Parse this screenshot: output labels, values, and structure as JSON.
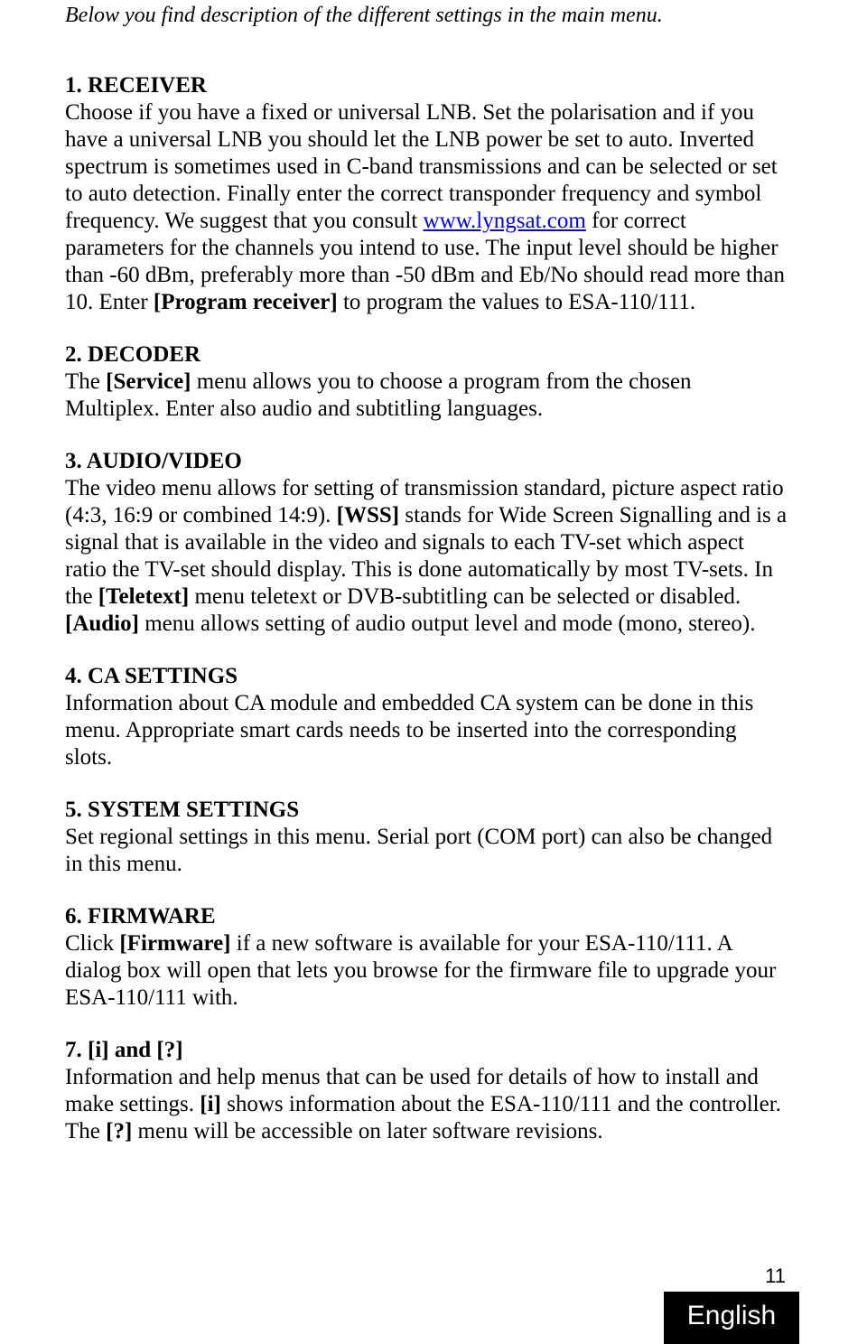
{
  "intro": "Below you find description of the different settings in the main menu.",
  "sections": {
    "s1": {
      "heading": "1. RECEIVER",
      "body_a": "Choose if you have a fixed or universal LNB. Set the polarisation and if you have a universal LNB you should let the LNB power be set to auto. Inverted spectrum is sometimes used in C-band transmissions and can be selected or set to auto detection. Finally enter the correct transponder frequency and symbol frequency. We suggest that you consult  ",
      "link": "www.lyngsat.com",
      "body_b": " for correct parameters for the channels you intend to use. The input level should be higher than -60 dBm, preferably more than -50 dBm and Eb/No should read more than 10. Enter ",
      "bold1": "[Program receiver]",
      "body_c": " to program the values to ESA-110/111."
    },
    "s2": {
      "heading": "2. DECODER",
      "body_a": "The ",
      "bold1": "[Service]",
      "body_b": " menu allows you to choose a program from the chosen Multiplex. Enter also audio and subtitling languages."
    },
    "s3": {
      "heading": "3. AUDIO/VIDEO",
      "body_a": "The video menu allows for setting of transmission standard, picture aspect ratio (4:3, 16:9 or combined 14:9). ",
      "bold1": "[WSS]",
      "body_b": " stands for Wide Screen Signalling and is a signal that is available in the video and signals to each TV-set which aspect ratio the TV-set should display. This is done automatically by most TV-sets. In the ",
      "bold2": "[Teletext]",
      "body_c": " menu teletext or DVB-subtitling can be selected or disabled. ",
      "bold3": "[Audio]",
      "body_d": " menu allows setting of audio output level and mode (mono, stereo)."
    },
    "s4": {
      "heading": "4. CA SETTINGS",
      "body_a": "Information about CA module and embedded CA system can be done in this menu. Appropriate smart cards needs to be inserted into the corresponding slots."
    },
    "s5": {
      "heading": "5. SYSTEM SETTINGS",
      "body_a": "Set regional settings in this menu. Serial port (COM port) can also be changed in this menu."
    },
    "s6": {
      "heading": "6. FIRMWARE",
      "body_a": "Click ",
      "bold1": "[Firmware]",
      "body_b": " if a new software is available for your ESA-110/111. A dialog box will open that lets you browse for the firmware file to upgrade your ESA-110/111 with."
    },
    "s7": {
      "heading": "7. [i] and [?]",
      "body_a": "Information and help menus that can be used for details of how to install and make settings. ",
      "bold1": "[i]",
      "body_b": " shows information about the ESA-110/111 and the controller. The ",
      "bold2": "[?]",
      "body_c": " menu will be accessible on later software revisions."
    }
  },
  "pagenum": "11",
  "language": "English"
}
